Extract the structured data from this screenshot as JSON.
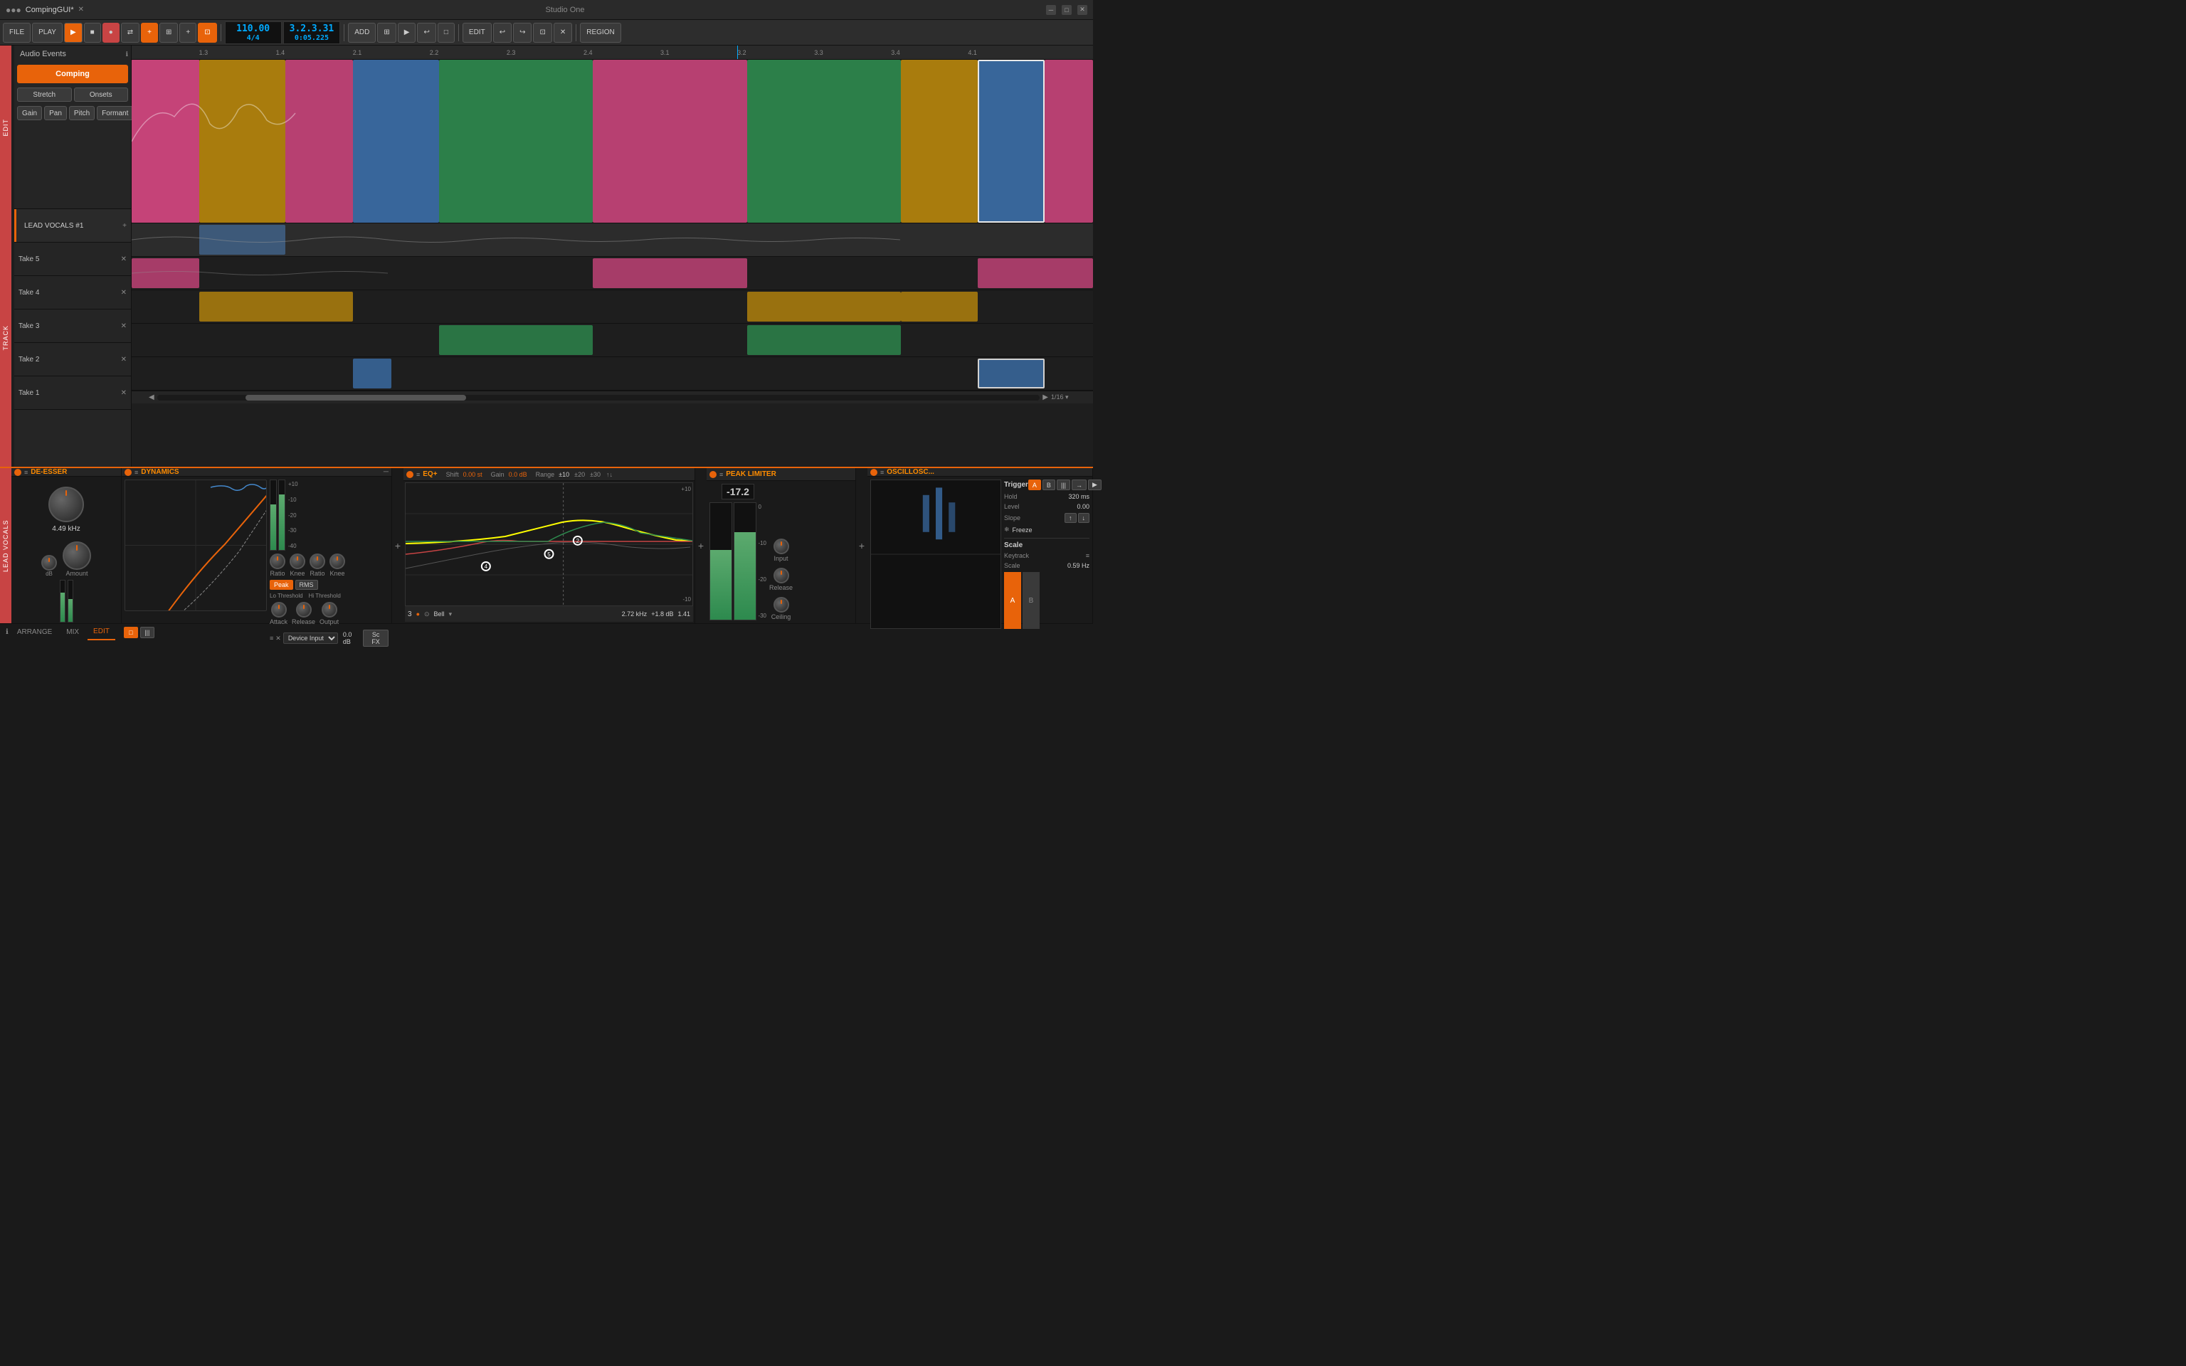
{
  "titlebar": {
    "title": "CompingGUI*",
    "logo": "●●●",
    "window_controls": [
      "minimize",
      "maximize",
      "close"
    ]
  },
  "toolbar": {
    "file_label": "FILE",
    "play_label": "PLAY",
    "tempo": "110.00",
    "time_sig": "4/4",
    "position": "3.2.3.31",
    "time": "0:05.225",
    "add_label": "ADD",
    "edit_label": "EDIT",
    "region_label": "REGION"
  },
  "track_panel": {
    "audio_events_label": "Audio Events",
    "comping_label": "Comping",
    "stretch_label": "Stretch",
    "onsets_label": "Onsets",
    "gain_label": "Gain",
    "pan_label": "Pan",
    "pitch_label": "Pitch",
    "formant_label": "Formant"
  },
  "tracks": {
    "main_label": "LEAD VOCALS #1",
    "takes": [
      {
        "label": "Take 5"
      },
      {
        "label": "Take 4"
      },
      {
        "label": "Take 3"
      },
      {
        "label": "Take 2"
      },
      {
        "label": "Take 1"
      }
    ]
  },
  "timeline": {
    "markers": [
      "1.3",
      "1.4",
      "2.1",
      "2.2",
      "2.3",
      "2.4",
      "3.1",
      "3.2",
      "3.3",
      "3.4",
      "4.1"
    ]
  },
  "de_esser": {
    "name": "DE-ESSER",
    "freq_value": "4.49 kHz",
    "amount_label": "Amount"
  },
  "dynamics": {
    "name": "DYNAMICS",
    "lo_threshold_label": "Lo Threshold",
    "hi_threshold_label": "Hi Threshold",
    "ratio1_label": "Ratio",
    "knee1_label": "Knee",
    "ratio2_label": "Ratio",
    "knee2_label": "Knee",
    "attack_label": "Attack",
    "release_label": "Release",
    "output_label": "Output",
    "peak_label": "Peak",
    "rms_label": "RMS",
    "device_input_label": "Device Input",
    "sc_fx_label": "Sc FX",
    "gain_value": "0.0 dB"
  },
  "eq": {
    "name": "EQ+",
    "shift_label": "Shift",
    "shift_value": "0.00 st",
    "gain_label": "Gain",
    "gain_value": "0.0 dB",
    "range_label": "Range",
    "range_value": "±10",
    "range_20": "±20",
    "range_30": "±30",
    "freq_value": "2.72 kHz",
    "gain_db_value": "+1.8 dB",
    "q_value": "1.41",
    "band_num": "3",
    "band_type": "Bell"
  },
  "peak_limiter": {
    "name": "PEAK LIMITER",
    "level_value": "-17.2",
    "input_label": "Input",
    "release_label": "Release",
    "ceiling_label": "Ceiling"
  },
  "oscilloscope": {
    "name": "OSCILLOSC...",
    "trigger_label": "Trigger",
    "hold_label": "Hold",
    "hold_value": "320 ms",
    "level_label": "Level",
    "level_value": "0.00",
    "slope_label": "Slope",
    "freeze_label": "Freeze",
    "scale_label": "Scale",
    "keytrack_label": "Keytrack",
    "scale_value": "0.59 Hz",
    "tab_a": "A",
    "tab_b": "B",
    "tab_bars": "|||",
    "tab_arrow": "→"
  },
  "status_bar": {
    "arrange_label": "ARRANGE",
    "mix_label": "MIX",
    "edit_label": "EDIT",
    "page_fraction": "1/16 ▾"
  },
  "lead_vocals_label": "LEAD VOCALS"
}
